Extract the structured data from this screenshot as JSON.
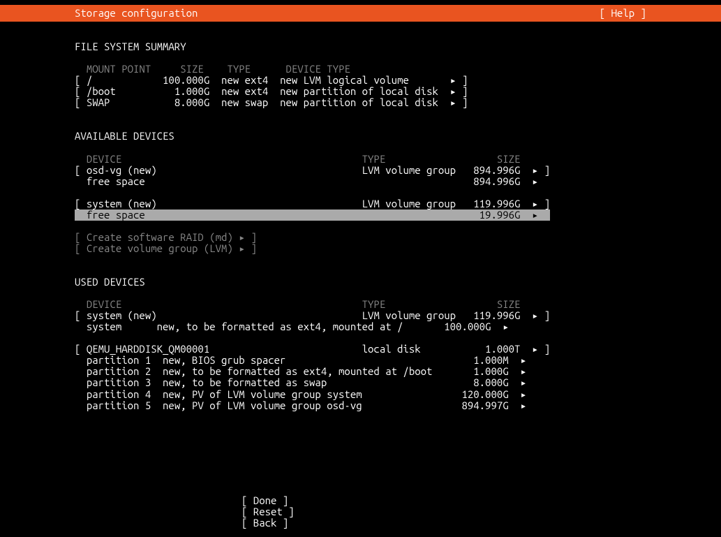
{
  "titlebar": {
    "title": "Storage configuration",
    "help": "[ Help ]"
  },
  "sections": {
    "file_system_summary": {
      "heading": "FILE SYSTEM SUMMARY",
      "headers": {
        "mount_point": "MOUNT POINT",
        "size": "SIZE",
        "type": "TYPE",
        "device_type": "DEVICE TYPE"
      },
      "rows": [
        {
          "mount": "/",
          "size": "100.000G",
          "type": "new ext4",
          "devtype": "new LVM logical volume"
        },
        {
          "mount": "/boot",
          "size": "1.000G",
          "type": "new ext4",
          "devtype": "new partition of local disk"
        },
        {
          "mount": "SWAP",
          "size": "8.000G",
          "type": "new swap",
          "devtype": "new partition of local disk"
        }
      ]
    },
    "available_devices": {
      "heading": "AVAILABLE DEVICES",
      "headers": {
        "device": "DEVICE",
        "type": "TYPE",
        "size": "SIZE"
      },
      "group1": {
        "main": {
          "device": "osd-vg (new)",
          "type": "LVM volume group",
          "size": "894.996G"
        },
        "child": {
          "device": "free space",
          "type": "",
          "size": "894.996G"
        }
      },
      "group2": {
        "main": {
          "device": "system (new)",
          "type": "LVM volume group",
          "size": "119.996G"
        },
        "child": {
          "device": "free space",
          "type": "",
          "size": "19.996G"
        }
      },
      "actions": {
        "raid": "Create software RAID (md)",
        "lvm": "Create volume group (LVM)"
      }
    },
    "used_devices": {
      "heading": "USED DEVICES",
      "headers": {
        "device": "DEVICE",
        "type": "TYPE",
        "size": "SIZE"
      },
      "group1": {
        "main": {
          "device": "system (new)",
          "type": "LVM volume group",
          "size": "119.996G"
        },
        "child": {
          "device": "system",
          "desc": "new, to be formatted as ext4, mounted at /",
          "size": "100.000G"
        }
      },
      "group2": {
        "main": {
          "device": "QEMU_HARDDISK_QM00001",
          "type": "local disk",
          "size": "1.000T"
        },
        "children": [
          {
            "device": "partition 1",
            "desc": "new, BIOS grub spacer",
            "size": "1.000M"
          },
          {
            "device": "partition 2",
            "desc": "new, to be formatted as ext4, mounted at /boot",
            "size": "1.000G"
          },
          {
            "device": "partition 3",
            "desc": "new, to be formatted as swap",
            "size": "8.000G"
          },
          {
            "device": "partition 4",
            "desc": "new, PV of LVM volume group system",
            "size": "120.000G"
          },
          {
            "device": "partition 5",
            "desc": "new, PV of LVM volume group osd-vg",
            "size": "894.997G"
          }
        ]
      }
    }
  },
  "footer": {
    "done": "Done",
    "reset": "Reset",
    "back": "Back"
  }
}
